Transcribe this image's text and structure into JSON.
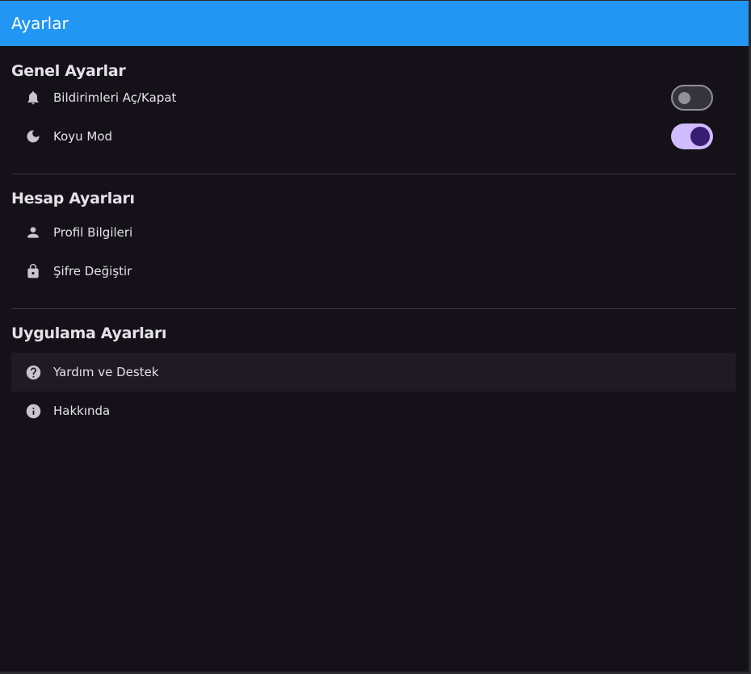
{
  "appbar": {
    "title": "Ayarlar"
  },
  "sections": {
    "general": {
      "title": "Genel Ayarlar",
      "notifications": {
        "label": "Bildirimleri Aç/Kapat",
        "icon": "bell-icon",
        "enabled": false
      },
      "dark_mode": {
        "label": "Koyu Mod",
        "icon": "moon-icon",
        "enabled": true
      }
    },
    "account": {
      "title": "Hesap Ayarları",
      "profile": {
        "label": "Profil Bilgileri",
        "icon": "person-icon"
      },
      "password": {
        "label": "Şifre Değiştir",
        "icon": "lock-icon"
      }
    },
    "app": {
      "title": "Uygulama Ayarları",
      "help": {
        "label": "Yardım ve Destek",
        "icon": "help-icon"
      },
      "about": {
        "label": "Hakkında",
        "icon": "info-icon"
      }
    }
  },
  "colors": {
    "appbar": "#2196f3",
    "background": "#141218",
    "toggle_on_track": "#d0bcff",
    "toggle_on_knob": "#381e72",
    "toggle_off_track": "#36343b",
    "toggle_off_outline": "#938f99"
  }
}
